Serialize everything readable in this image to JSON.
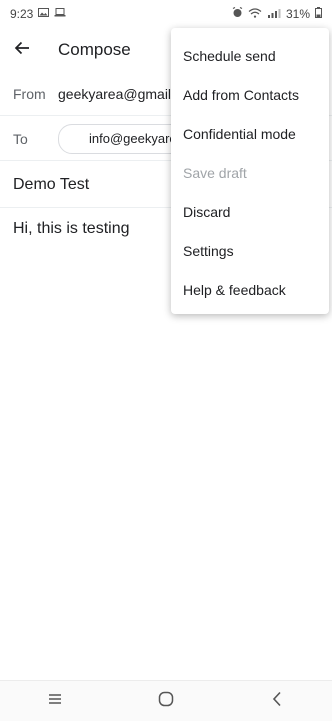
{
  "status_bar": {
    "time": "9:23",
    "battery": "31%"
  },
  "header": {
    "title": "Compose"
  },
  "compose": {
    "from_label": "From",
    "from_value": "geekyarea@gmail",
    "to_label": "To",
    "to_chip": "info@geekyare",
    "subject": "Demo Test",
    "body": "Hi, this is testing"
  },
  "menu": {
    "items": [
      {
        "label": "Schedule send"
      },
      {
        "label": "Add from Contacts"
      },
      {
        "label": "Confidential mode"
      },
      {
        "label": "Save draft",
        "disabled": true
      },
      {
        "label": "Discard"
      },
      {
        "label": "Settings"
      },
      {
        "label": "Help & feedback"
      }
    ]
  },
  "colors": {
    "disabled_text": "#a0a4a8",
    "divider": "#eceff1"
  },
  "icons": [
    "back-arrow-icon",
    "recent-apps-icon",
    "home-icon",
    "nav-back-icon"
  ]
}
